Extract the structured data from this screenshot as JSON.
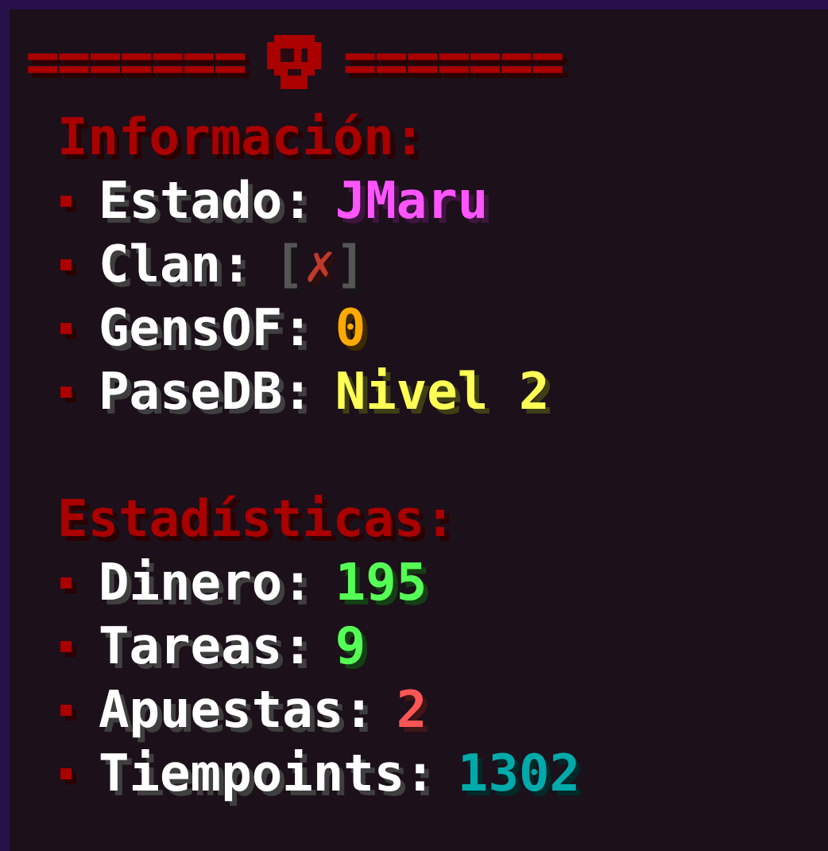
{
  "header": {
    "left_rule": "=======",
    "right_rule": "======="
  },
  "sections": [
    {
      "title": "Información:",
      "items": [
        {
          "label": "Estado:",
          "value": [
            {
              "text": "JMaru",
              "color": "#ff55ff"
            }
          ]
        },
        {
          "label": "Clan:",
          "value": [
            {
              "text": "[",
              "color": "#555555"
            },
            {
              "text": "✗",
              "color": "#c0392b"
            },
            {
              "text": "]",
              "color": "#555555"
            }
          ]
        },
        {
          "label": "GensOF:",
          "value": [
            {
              "text": "0",
              "color": "#ffaa00"
            }
          ]
        },
        {
          "label": "PaseDB:",
          "value": [
            {
              "text": "Nivel 2",
              "color": "#ffff55"
            }
          ]
        }
      ]
    },
    {
      "title": "Estadísticas:",
      "items": [
        {
          "label": "Dinero:",
          "value": [
            {
              "text": "195",
              "color": "#55ff55"
            }
          ]
        },
        {
          "label": "Tareas:",
          "value": [
            {
              "text": "9",
              "color": "#55ff55"
            }
          ]
        },
        {
          "label": "Apuestas:",
          "value": [
            {
              "text": "2",
              "color": "#ff5555"
            }
          ]
        },
        {
          "label": "Tiempoints:",
          "value": [
            {
              "text": "1302",
              "color": "#00aaaa"
            }
          ]
        }
      ]
    }
  ]
}
